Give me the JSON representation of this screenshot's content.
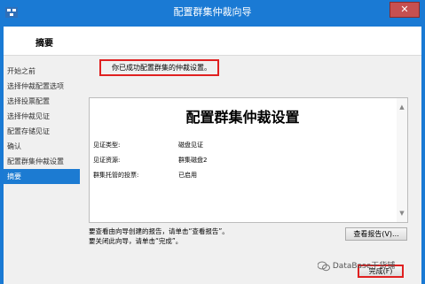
{
  "window": {
    "title": "配置群集仲裁向导",
    "close_glyph": "✕",
    "accent_color": "#1a7ad4"
  },
  "header": {
    "heading": "摘要"
  },
  "nav": {
    "items": [
      {
        "label": "开始之前"
      },
      {
        "label": "选择仲裁配置选项"
      },
      {
        "label": "选择投票配置"
      },
      {
        "label": "选择仲裁见证"
      },
      {
        "label": "配置存储见证"
      },
      {
        "label": "确认"
      },
      {
        "label": "配置群集仲裁设置"
      },
      {
        "label": "摘要",
        "selected": true
      }
    ]
  },
  "main": {
    "success_message": "你已成功配置群集的仲裁设置。",
    "report": {
      "title": "配置群集仲裁设置",
      "rows": [
        {
          "key": "见证类型:",
          "value": "磁盘见证"
        },
        {
          "key": "见证资源:",
          "value": "群集磁盘2"
        },
        {
          "key": "群集托管的投票:",
          "value": "已启用"
        }
      ]
    },
    "hint_line1": "要查看由向导创建的报告，请单击“查看报告”。",
    "hint_line2": "要关闭此向导，请单击“完成”。",
    "view_report_label": "查看报告(V)...",
    "finish_label": "完成(F)"
  },
  "watermark": {
    "text": "DataBase干货铺"
  },
  "colors": {
    "highlight_red": "#e02020",
    "selected_nav": "#1c7bd2"
  }
}
